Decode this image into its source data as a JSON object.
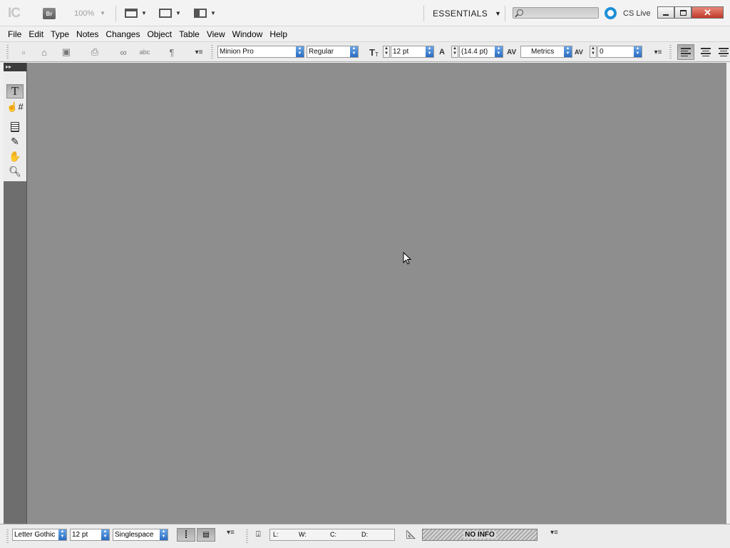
{
  "appbar": {
    "logo": "IC",
    "bridge_label": "Br",
    "zoom": "100%",
    "workspace": "ESSENTIALS",
    "search_placeholder": "",
    "cs_live": "CS Live"
  },
  "menu": [
    "File",
    "Edit",
    "Type",
    "Notes",
    "Changes",
    "Object",
    "Table",
    "View",
    "Window",
    "Help"
  ],
  "control": {
    "font_family": "Minion Pro",
    "font_style": "Regular",
    "font_size": "12 pt",
    "leading": "(14.4 pt)",
    "kerning": "Metrics",
    "tracking": "0",
    "paragraph_mark": "¶",
    "spell_label": "abc"
  },
  "tools": [
    "type-tool",
    "position-tool",
    "note-tool",
    "eyedropper-tool",
    "hand-tool",
    "zoom-tool"
  ],
  "status": {
    "font": "Letter Gothic",
    "size": "12 pt",
    "spacing": "Singlespace",
    "info_L": "L:",
    "info_W": "W:",
    "info_C": "C:",
    "info_D": "D:",
    "no_info": "NO INFO"
  },
  "colors": {
    "workspace_bg": "#8e8e8e",
    "cs_live_accent": "#1e8fd6",
    "close_button": "#c2392a"
  }
}
